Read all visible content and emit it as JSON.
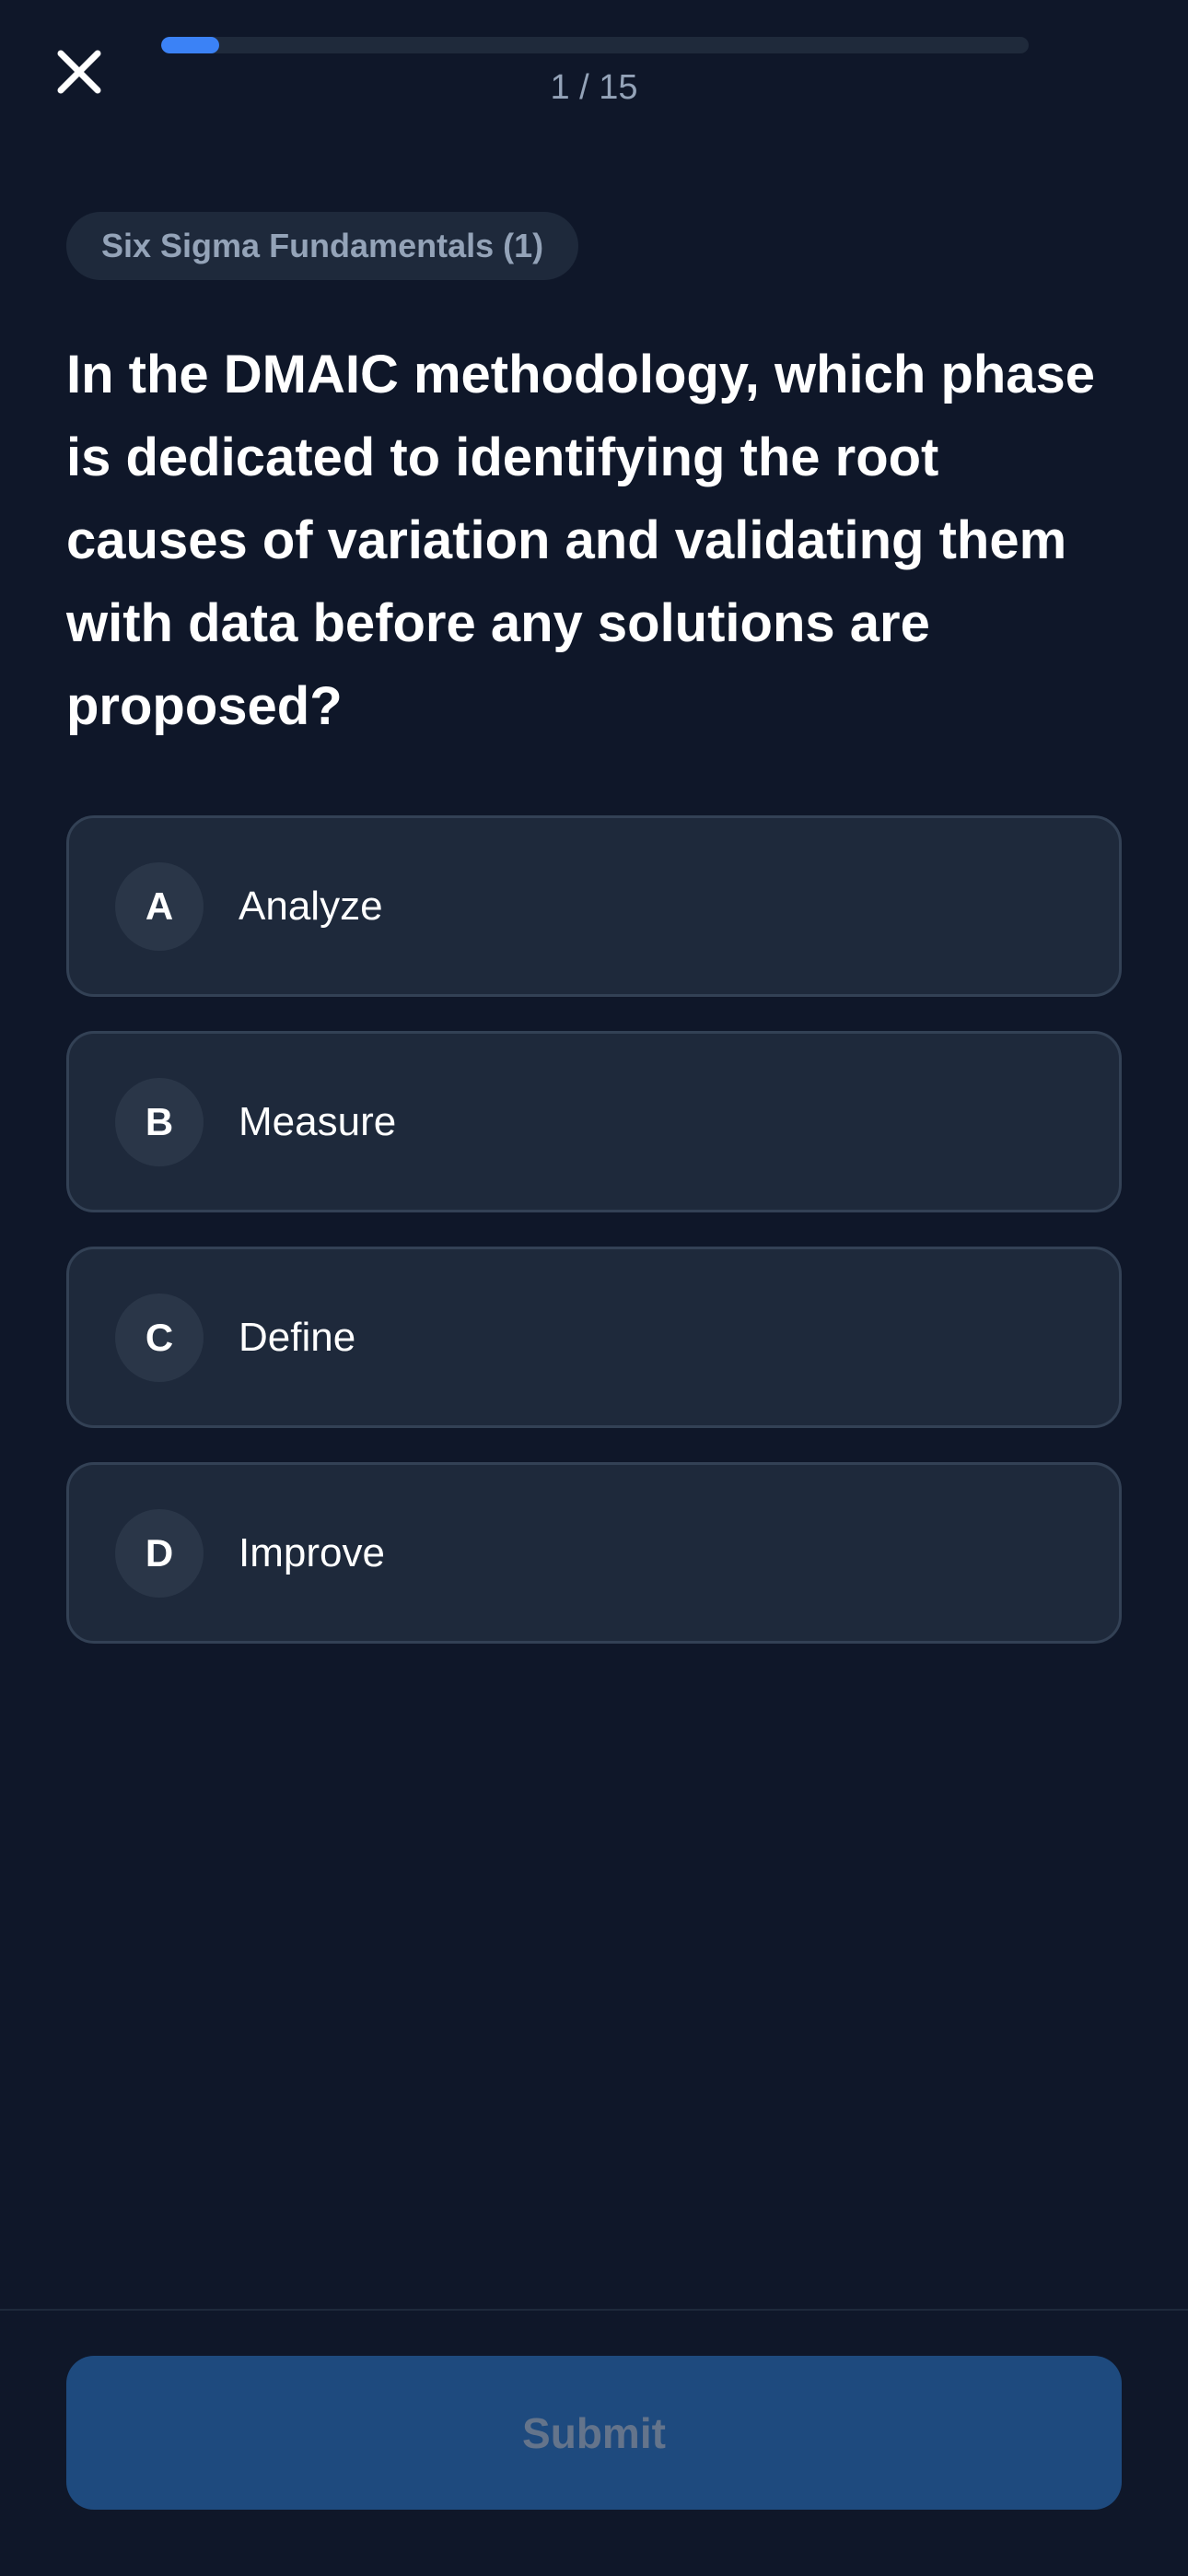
{
  "header": {
    "close_icon": "close-icon",
    "progress_fraction": 0.0667,
    "counter": "1 / 15"
  },
  "category": "Six Sigma Fundamentals (1)",
  "question": "In the DMAIC methodology, which phase is dedicated to identifying the root causes of variation and validating them with data before any solutions are proposed?",
  "options": [
    {
      "letter": "A",
      "label": "Analyze"
    },
    {
      "letter": "B",
      "label": "Measure"
    },
    {
      "letter": "C",
      "label": "Define"
    },
    {
      "letter": "D",
      "label": "Improve"
    }
  ],
  "footer": {
    "submit_label": "Submit",
    "submit_enabled": false
  },
  "colors": {
    "background": "#0f1729",
    "card": "#1e293b",
    "card_border": "#334155",
    "submit_disabled": "#1e4a7e",
    "muted_text": "#94a3b8"
  }
}
